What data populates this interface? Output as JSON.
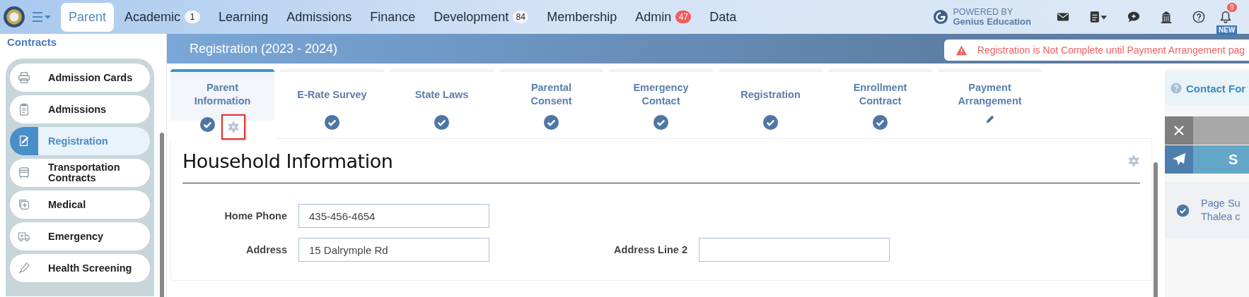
{
  "nav": {
    "items": [
      {
        "label": "Parent",
        "selected": true
      },
      {
        "label": "Academic",
        "selected": false,
        "badge": {
          "text": "1",
          "color": "#f4f6fa"
        }
      },
      {
        "label": "Learning",
        "selected": false
      },
      {
        "label": "Admissions",
        "selected": false
      },
      {
        "label": "Finance",
        "selected": false
      },
      {
        "label": "Development",
        "selected": false,
        "badge": {
          "text": "84",
          "color": "#f4f6fa"
        }
      },
      {
        "label": "Membership",
        "selected": false
      },
      {
        "label": "Admin",
        "selected": false,
        "badge": {
          "text": "47",
          "color": "#f25c5c"
        }
      },
      {
        "label": "Data",
        "selected": false
      }
    ],
    "powered_by": "POWERED BY",
    "brand": "Genius Education",
    "notification_badge": "9",
    "new_tag": "NEW"
  },
  "sidebar": {
    "title": "Contracts",
    "items": [
      {
        "label": "Admission Cards",
        "kind": "printer",
        "selected": false
      },
      {
        "label": "Admissions",
        "kind": "clipboard",
        "selected": false
      },
      {
        "label": "Registration",
        "kind": "signature",
        "selected": true
      },
      {
        "label": "Transportation Contracts",
        "kind": "bus",
        "selected": false
      },
      {
        "label": "Medical",
        "kind": "medical",
        "selected": false
      },
      {
        "label": "Emergency",
        "kind": "ambulance",
        "selected": false
      },
      {
        "label": "Health Screening",
        "kind": "thermometer",
        "selected": false
      }
    ]
  },
  "header": {
    "title": "Registration (2023 - 2024)",
    "alert": "Registration is Not Complete until Payment Arrangement pag"
  },
  "steps": [
    {
      "label": "Parent Information",
      "complete": true,
      "selected": true,
      "settings": true
    },
    {
      "label": "E-Rate Survey",
      "complete": true,
      "selected": false
    },
    {
      "label": "State Laws",
      "complete": true,
      "selected": false
    },
    {
      "label": "Parental Consent",
      "complete": true,
      "selected": false
    },
    {
      "label": "Emergency Contact",
      "complete": true,
      "selected": false
    },
    {
      "label": "Registration",
      "complete": true,
      "selected": false
    },
    {
      "label": "Enrollment Contract",
      "complete": true,
      "selected": false
    },
    {
      "label": "Payment Arrangement",
      "complete": false,
      "selected": false
    }
  ],
  "section": {
    "title": "Household Information",
    "fields": [
      {
        "label": "Home Phone",
        "value": "435-456-4654"
      },
      {
        "label": "Address",
        "value": "15 Dalrymple Rd"
      },
      {
        "label": "Address Line 2"
      }
    ]
  },
  "right_panel": {
    "contact": "Contact For",
    "send": "S",
    "message_line_1": "Page Su",
    "message_line_2": "Thalea c"
  }
}
